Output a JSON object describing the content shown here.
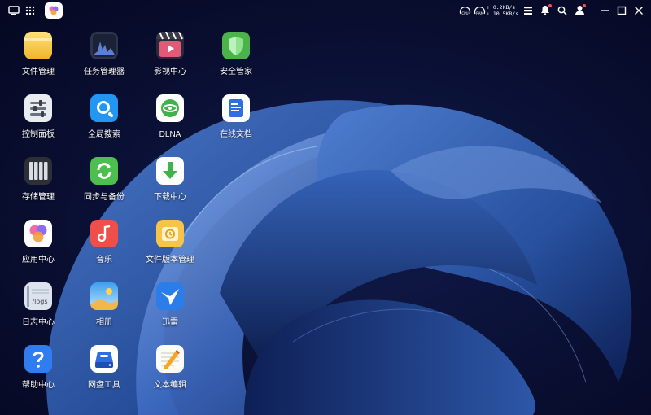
{
  "taskbar": {
    "network": {
      "upload": "0.2KB/s",
      "download": "10.5KB/s"
    },
    "icons": [
      "show-desktop-icon",
      "app-grid-icon",
      "app-center-icon",
      "network-monitor-icon",
      "storage-monitor-icon",
      "task-list-icon",
      "notification-icon",
      "search-icon",
      "user-icon",
      "minimize-icon",
      "maximize-icon",
      "close-icon"
    ]
  },
  "desktop": {
    "apps": [
      {
        "id": "file-manager",
        "label": "文件管理"
      },
      {
        "id": "task-manager",
        "label": "任务管理器"
      },
      {
        "id": "video-center",
        "label": "影视中心"
      },
      {
        "id": "security-manager",
        "label": "安全管家"
      },
      {
        "id": "control-panel",
        "label": "控制面板"
      },
      {
        "id": "global-search",
        "label": "全局搜索"
      },
      {
        "id": "dlna",
        "label": "DLNA"
      },
      {
        "id": "online-docs",
        "label": "在线文档"
      },
      {
        "id": "storage-manager",
        "label": "存储管理"
      },
      {
        "id": "sync-backup",
        "label": "同步与备份"
      },
      {
        "id": "download-center",
        "label": "下载中心"
      },
      {
        "id": "app-center",
        "label": "应用中心"
      },
      {
        "id": "music",
        "label": "音乐"
      },
      {
        "id": "file-versions",
        "label": "文件版本管理"
      },
      {
        "id": "log-center",
        "label": "日志中心"
      },
      {
        "id": "photo-album",
        "label": "相册"
      },
      {
        "id": "thunder",
        "label": "迅雷"
      },
      {
        "id": "help-center",
        "label": "帮助中心"
      },
      {
        "id": "disk-tools",
        "label": "网盘工具"
      },
      {
        "id": "text-editor",
        "label": "文本编辑"
      }
    ],
    "log_icon_text": "/logs"
  },
  "colors": {
    "background": "#070a24",
    "notification_dot": "#ff4d4d"
  }
}
